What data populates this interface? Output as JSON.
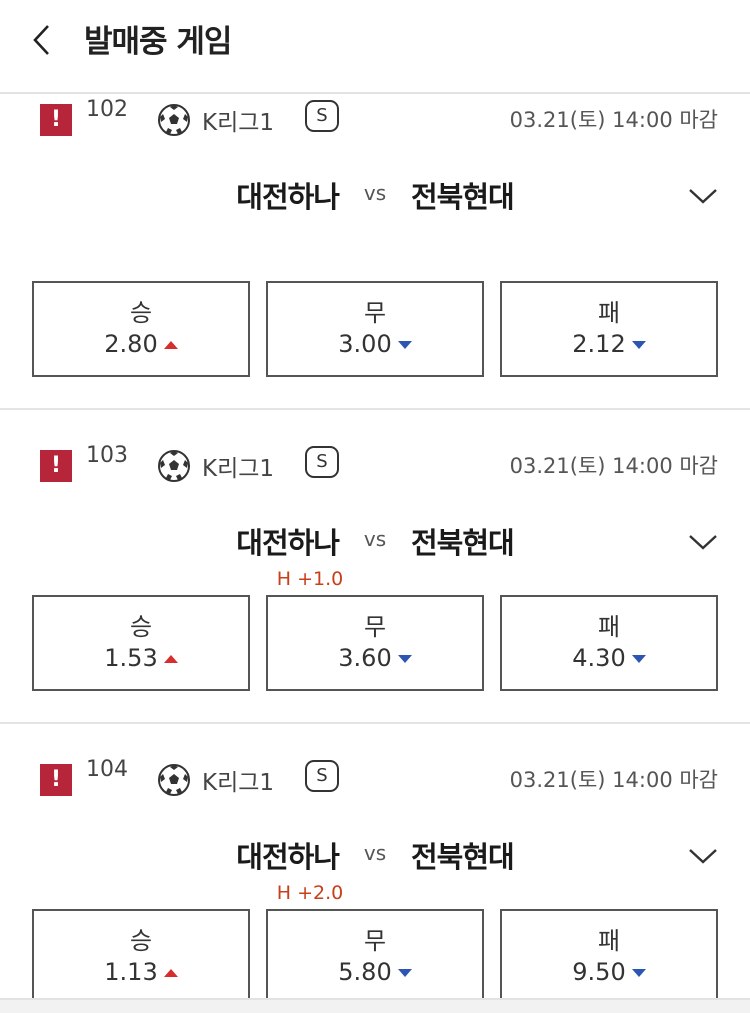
{
  "header": {
    "title": "발매중 게임"
  },
  "games": [
    {
      "no": "102",
      "league": "K리그1",
      "s_badge": "S",
      "deadline": "03.21(토) 14:00 마감",
      "home": "대전하나",
      "vs": "vs",
      "away": "전북현대",
      "handicap": "",
      "odds": [
        {
          "label": "승",
          "value": "2.80",
          "trend": "up"
        },
        {
          "label": "무",
          "value": "3.00",
          "trend": "down"
        },
        {
          "label": "패",
          "value": "2.12",
          "trend": "down"
        }
      ]
    },
    {
      "no": "103",
      "league": "K리그1",
      "s_badge": "S",
      "deadline": "03.21(토) 14:00 마감",
      "home": "대전하나",
      "vs": "vs",
      "away": "전북현대",
      "handicap": "H +1.0",
      "odds": [
        {
          "label": "승",
          "value": "1.53",
          "trend": "up"
        },
        {
          "label": "무",
          "value": "3.60",
          "trend": "down"
        },
        {
          "label": "패",
          "value": "4.30",
          "trend": "down"
        }
      ]
    },
    {
      "no": "104",
      "league": "K리그1",
      "s_badge": "S",
      "deadline": "03.21(토) 14:00 마감",
      "home": "대전하나",
      "vs": "vs",
      "away": "전북현대",
      "handicap": "H +2.0",
      "odds": [
        {
          "label": "승",
          "value": "1.13",
          "trend": "up"
        },
        {
          "label": "무",
          "value": "5.80",
          "trend": "down"
        },
        {
          "label": "패",
          "value": "9.50",
          "trend": "down"
        }
      ]
    }
  ],
  "icons": {
    "alert": "exclamation-icon",
    "ball": "soccer-ball-icon",
    "back": "chevron-left-icon",
    "expand": "chevron-down-icon"
  },
  "colors": {
    "alert": "#b7253a",
    "up": "#d62d2d",
    "down": "#2d56b3",
    "handicap": "#c8401a"
  }
}
